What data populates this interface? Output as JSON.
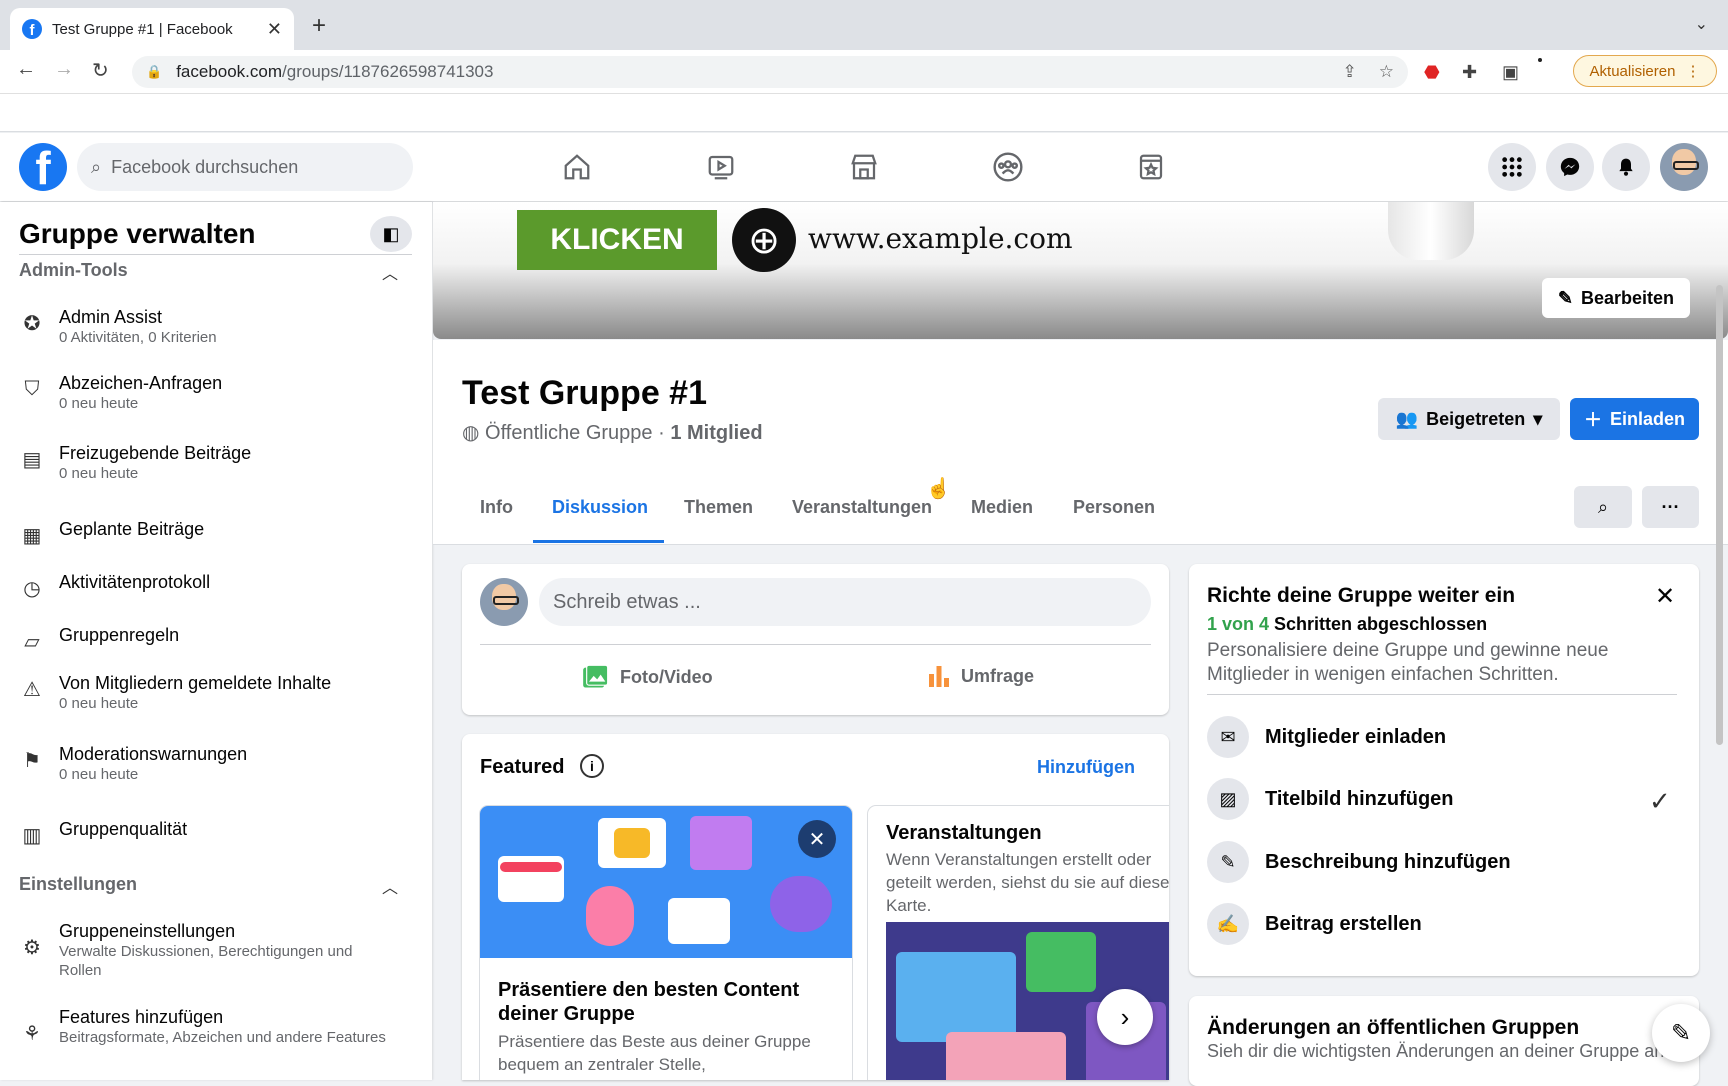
{
  "browser": {
    "tab_title": "Test Gruppe #1 | Facebook",
    "tab_close": "✕",
    "new_tab": "+",
    "url_host": "facebook.com",
    "url_path": "/groups/1187626598741303",
    "update_label": "Aktualisieren"
  },
  "fb": {
    "logo_letter": "f",
    "search_placeholder": "Facebook durchsuchen"
  },
  "sidebar": {
    "title": "Gruppe verwalten",
    "section_admin": "Admin-Tools",
    "section_settings": "Einstellungen",
    "items": [
      {
        "label": "Admin Assist",
        "sub": "0 Aktivitäten, 0 Kriterien"
      },
      {
        "label": "Abzeichen-Anfragen",
        "sub": "0 neu heute"
      },
      {
        "label": "Freizugebende Beiträge",
        "sub": "0 neu heute"
      },
      {
        "label": "Geplante Beiträge",
        "sub": ""
      },
      {
        "label": "Aktivitätenprotokoll",
        "sub": ""
      },
      {
        "label": "Gruppenregeln",
        "sub": ""
      },
      {
        "label": "Von Mitgliedern gemeldete Inhalte",
        "sub": "0 neu heute"
      },
      {
        "label": "Moderationswarnungen",
        "sub": "0 neu heute"
      },
      {
        "label": "Gruppenqualität",
        "sub": ""
      }
    ],
    "settings_items": [
      {
        "label": "Gruppeneinstellungen",
        "sub": "Verwalte Diskussionen, Berechtigungen und Rollen"
      },
      {
        "label": "Features hinzufügen",
        "sub": "Beitragsformate, Abzeichen und andere Features"
      }
    ]
  },
  "cover": {
    "button_text": "KLICKEN",
    "url_text": "www.example.com",
    "edit_label": "Bearbeiten"
  },
  "group": {
    "name": "Test Gruppe #1",
    "privacy": "Öffentliche Gruppe · ",
    "members": "1 Mitglied",
    "joined_label": "Beigetreten",
    "invite_label": "Einladen",
    "tabs": [
      "Info",
      "Diskussion",
      "Themen",
      "Veranstaltungen",
      "Medien",
      "Personen"
    ],
    "more_label": "···"
  },
  "composer": {
    "placeholder": "Schreib etwas ...",
    "photo_label": "Foto/Video",
    "poll_label": "Umfrage"
  },
  "featured": {
    "title": "Featured",
    "info": "i",
    "add_label": "Hinzufügen",
    "card1_title": "Präsentiere den besten Content deiner Gruppe",
    "card1_desc": "Präsentiere das Beste aus deiner Gruppe bequem an zentraler Stelle,",
    "card2_title": "Veranstaltungen",
    "card2_desc": "Wenn Veranstaltungen erstellt oder geteilt werden, siehst du sie auf dieser Karte."
  },
  "setup": {
    "title": "Richte deine Gruppe weiter ein",
    "progress_done": "1 von 4",
    "progress_rest": " Schritten abgeschlossen",
    "desc": "Personalisiere deine Gruppe und gewinne neue Mitglieder in wenigen einfachen Schritten.",
    "steps": [
      "Mitglieder einladen",
      "Titelbild hinzufügen",
      "Beschreibung hinzufügen",
      "Beitrag erstellen"
    ]
  },
  "changes": {
    "title": "Änderungen an öffentlichen Gruppen",
    "desc": "Sieh dir die wichtigsten Änderungen an deiner Gruppe an."
  },
  "colors": {
    "fb_blue": "#1877f2",
    "accent": "#1b74e4",
    "green": "#31a24c"
  }
}
